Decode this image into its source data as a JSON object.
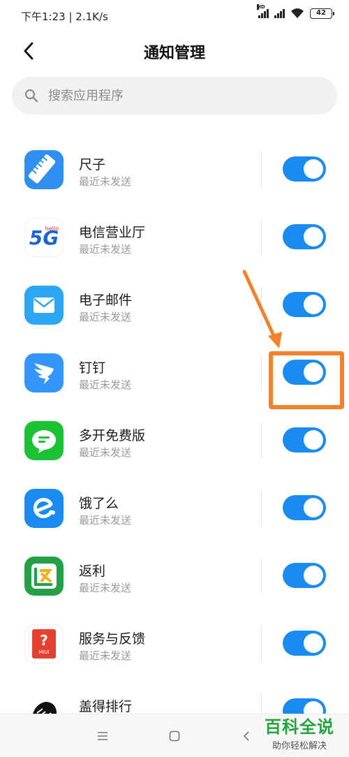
{
  "status_bar": {
    "time": "下午1:23 | 2.1K/s",
    "network_label": "HD",
    "battery": "42"
  },
  "header": {
    "title": "通知管理"
  },
  "search": {
    "placeholder": "搜索应用程序"
  },
  "apps": [
    {
      "name": "尺子",
      "status": "最近未发送",
      "icon": "ruler-icon",
      "enabled": true
    },
    {
      "name": "电信营业厅",
      "status": "最近未发送",
      "icon": "5g-hello-icon",
      "icon_text": "5G",
      "icon_small": "hello",
      "enabled": true
    },
    {
      "name": "电子邮件",
      "status": "最近未发送",
      "icon": "mail-icon",
      "enabled": true
    },
    {
      "name": "钉钉",
      "status": "最近未发送",
      "icon": "dingtalk-icon",
      "enabled": true
    },
    {
      "name": "多开免费版",
      "status": "最近未发送",
      "icon": "chat-bubble-icon",
      "enabled": true
    },
    {
      "name": "饿了么",
      "status": "最近未发送",
      "icon": "eleme-icon",
      "enabled": true
    },
    {
      "name": "返利",
      "status": "最近未发送",
      "icon": "fanli-icon",
      "enabled": true
    },
    {
      "name": "服务与反馈",
      "status": "最近未发送",
      "icon": "feedback-icon",
      "icon_text": "MIUI",
      "enabled": true
    },
    {
      "name": "盖得排行",
      "status": "",
      "icon": "lion-icon",
      "enabled": true
    }
  ],
  "watermark": {
    "title": "百科全说",
    "subtitle": "助你轻松解决"
  },
  "colors": {
    "toggle_on": "#1a8cf0",
    "annotation": "#f4812c",
    "watermark": "#23a33b"
  }
}
